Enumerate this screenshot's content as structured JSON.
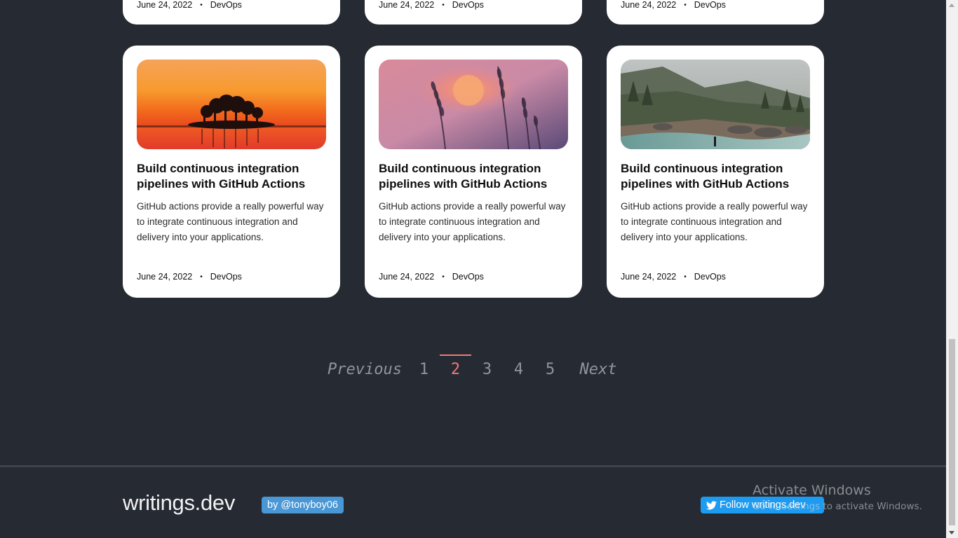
{
  "top_cards": [
    {
      "date": "June 24, 2022",
      "category": "DevOps"
    },
    {
      "date": "June 24, 2022",
      "category": "DevOps"
    },
    {
      "date": "June 24, 2022",
      "category": "DevOps"
    }
  ],
  "cards": [
    {
      "image": "sunset-island-image",
      "title": "Build continuous integration pipelines with GitHub Actions",
      "description": "GitHub actions provide a really powerful way to integrate continuous integration and delivery into your applications.",
      "date": "June 24, 2022",
      "category": "DevOps"
    },
    {
      "image": "grass-sunset-image",
      "title": "Build continuous integration pipelines with GitHub Actions",
      "description": "GitHub actions provide a really powerful way to integrate continuous integration and delivery into your applications.",
      "date": "June 24, 2022",
      "category": "DevOps"
    },
    {
      "image": "mountain-river-image",
      "title": "Build continuous integration pipelines with GitHub Actions",
      "description": "GitHub actions provide a really powerful way to integrate continuous integration and delivery into your applications.",
      "date": "June 24, 2022",
      "category": "DevOps"
    }
  ],
  "meta_separator": "•",
  "pagination": {
    "previous": "Previous",
    "pages": [
      "1",
      "2",
      "3",
      "4",
      "5"
    ],
    "current": "2",
    "next": "Next"
  },
  "footer": {
    "brand": "writings.dev",
    "by_badge": "by @tonyboy06",
    "follow_button": "Follow writings.dev",
    "follow_icon": "twitter-bird-icon"
  },
  "os_watermark": {
    "line1": "Activate Windows",
    "line2": "Go to Settings to activate Windows."
  },
  "colors": {
    "background": "#252a33",
    "card": "#ffffff",
    "active_page": "#f07a78",
    "badge": "#4a97d6",
    "twitter": "#1d9bf0"
  }
}
